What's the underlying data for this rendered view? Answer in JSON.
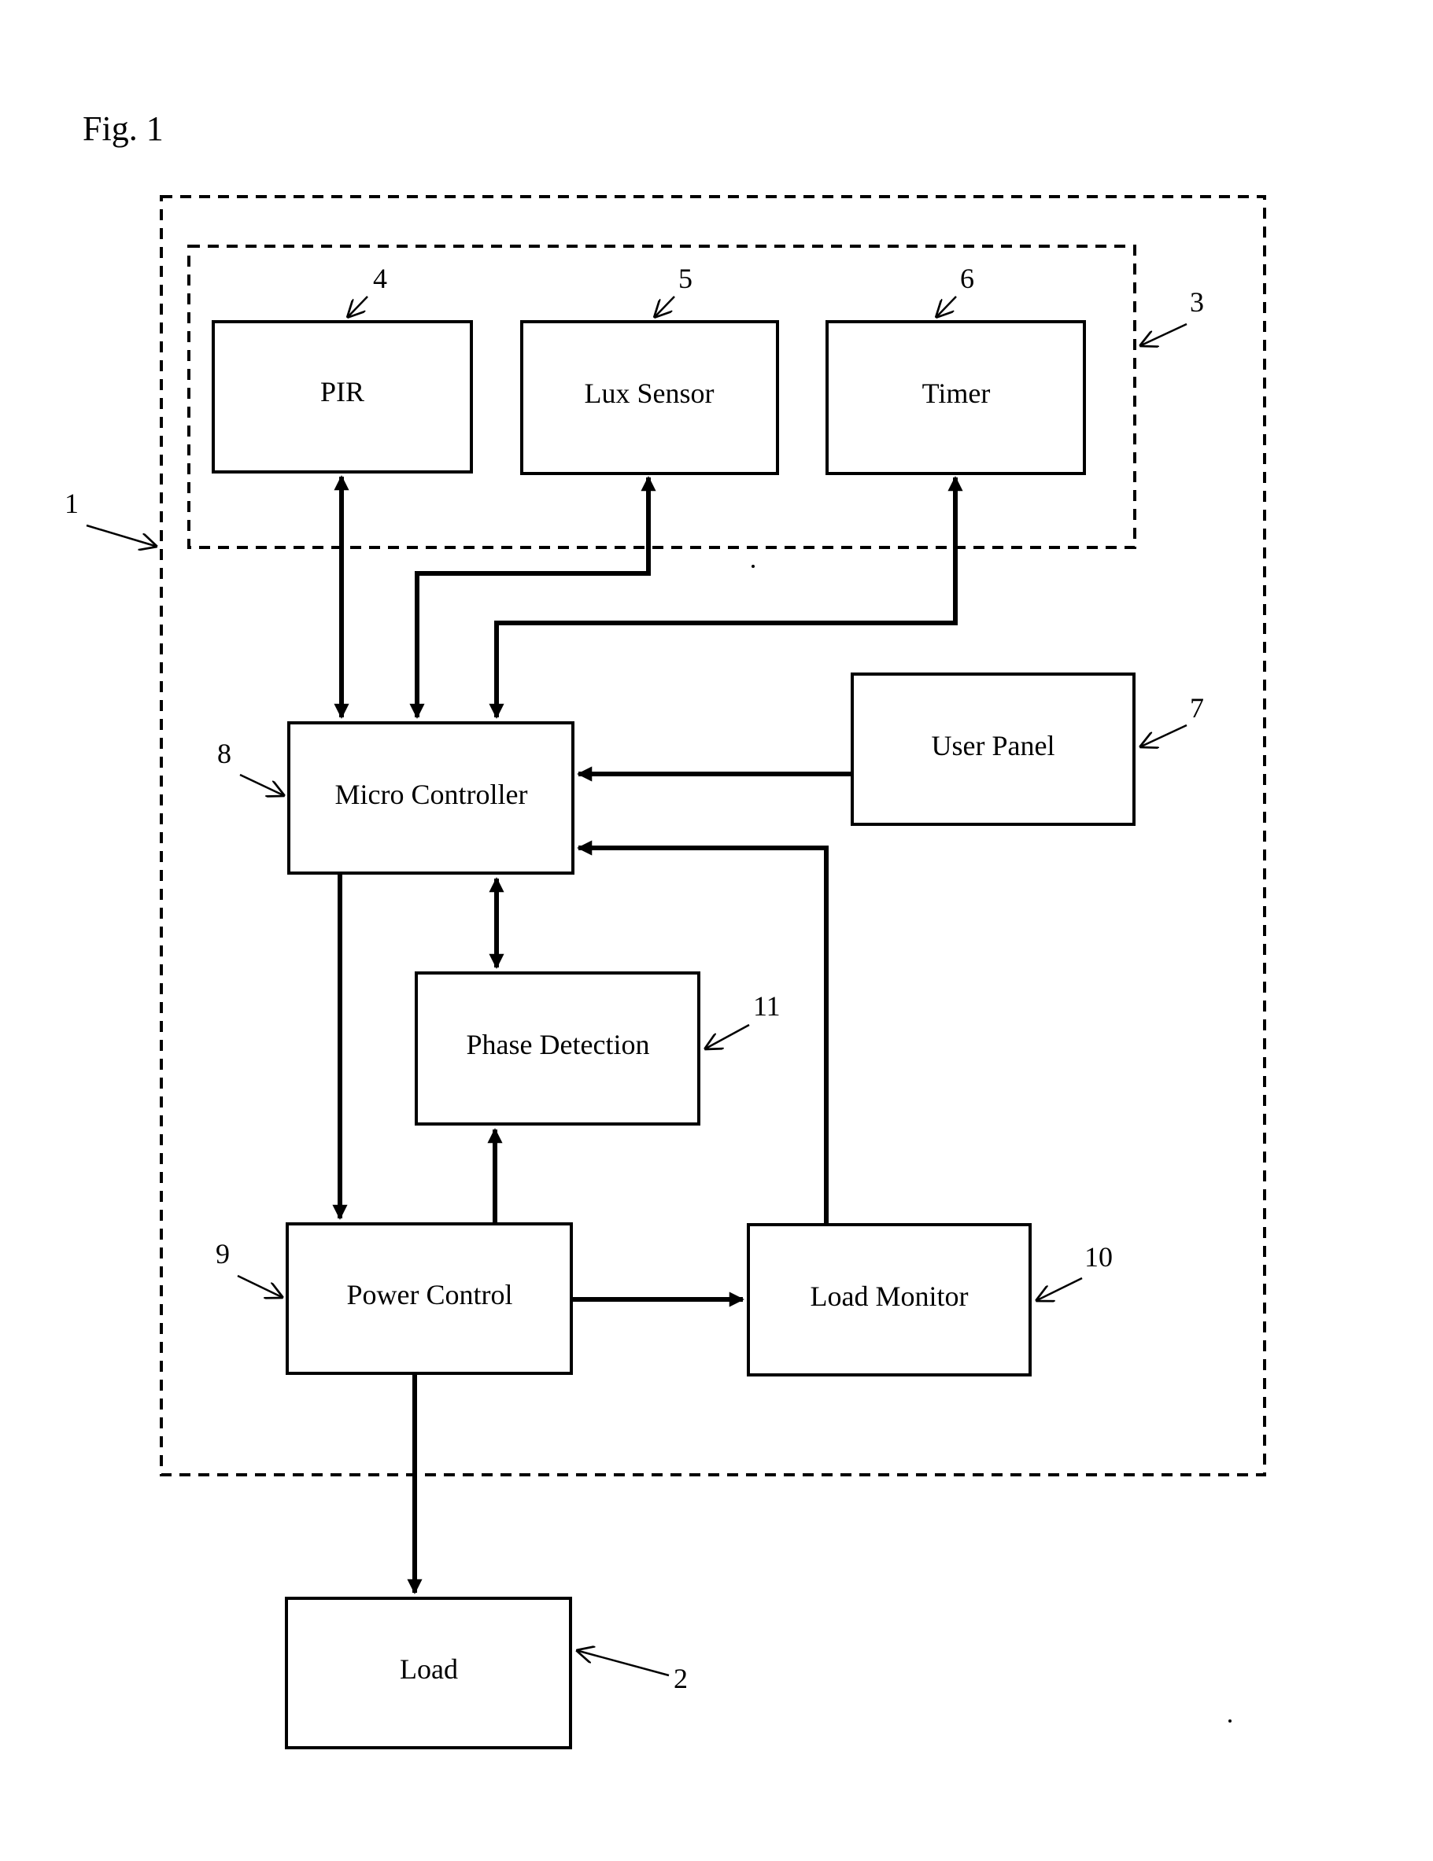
{
  "figure": {
    "title": "Fig. 1"
  },
  "groups": {
    "device": {
      "ref": "1"
    },
    "sensors": {
      "ref": "3"
    }
  },
  "blocks": {
    "load": {
      "label": "Load",
      "ref": "2"
    },
    "pir": {
      "label": "PIR",
      "ref": "4"
    },
    "lux_sensor": {
      "label": "Lux Sensor",
      "ref": "5"
    },
    "timer": {
      "label": "Timer",
      "ref": "6"
    },
    "user_panel": {
      "label": "User Panel",
      "ref": "7"
    },
    "micro_controller": {
      "label": "Micro Controller",
      "ref": "8"
    },
    "power_control": {
      "label": "Power Control",
      "ref": "9"
    },
    "load_monitor": {
      "label": "Load Monitor",
      "ref": "10"
    },
    "phase_detection": {
      "label": "Phase Detection",
      "ref": "11"
    }
  },
  "connections": [
    {
      "from": "PIR",
      "to": "Micro Controller",
      "direction": "bidirectional"
    },
    {
      "from": "Lux Sensor",
      "to": "Micro Controller",
      "direction": "bidirectional"
    },
    {
      "from": "Timer",
      "to": "Micro Controller",
      "direction": "bidirectional"
    },
    {
      "from": "User Panel",
      "to": "Micro Controller",
      "direction": "forward"
    },
    {
      "from": "Load Monitor",
      "to": "Micro Controller",
      "direction": "forward"
    },
    {
      "from": "Micro Controller",
      "to": "Phase Detection",
      "direction": "bidirectional"
    },
    {
      "from": "Micro Controller",
      "to": "Power Control",
      "direction": "forward"
    },
    {
      "from": "Power Control",
      "to": "Phase Detection",
      "direction": "forward"
    },
    {
      "from": "Power Control",
      "to": "Load Monitor",
      "direction": "forward"
    },
    {
      "from": "Power Control",
      "to": "Load",
      "direction": "forward"
    }
  ]
}
